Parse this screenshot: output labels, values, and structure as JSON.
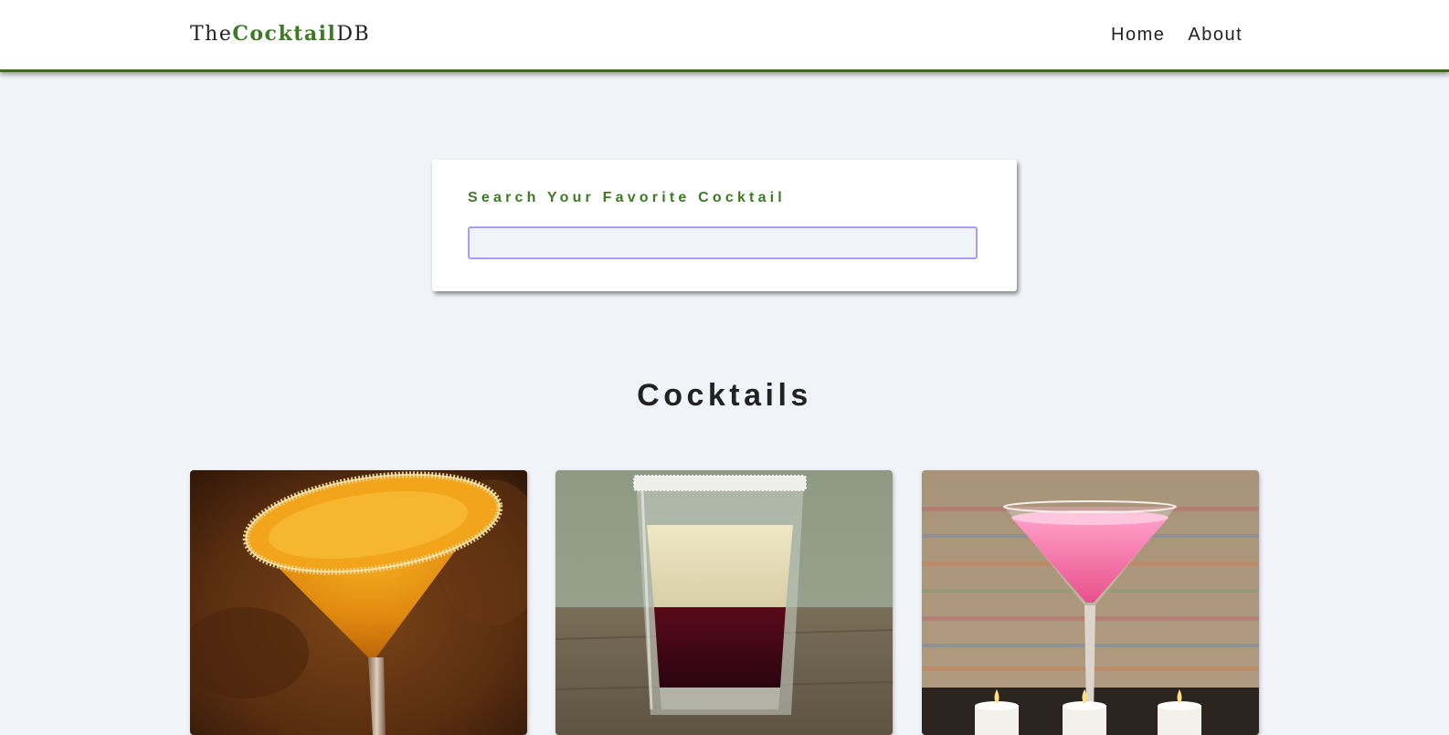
{
  "navbar": {
    "logo": {
      "prefix": "The",
      "highlight": "Cocktail",
      "suffix": "DB"
    },
    "links": [
      "Home",
      "About"
    ]
  },
  "search": {
    "label": "Search Your Favorite Cocktail",
    "value": "",
    "placeholder": ""
  },
  "cocktails": {
    "title": "Cocktails",
    "items": [
      {
        "image": "orange-martini-sugar-rim-photo"
      },
      {
        "image": "layered-shot-glass-photo"
      },
      {
        "image": "pink-martini-candles-photo"
      }
    ]
  },
  "colors": {
    "brand_green": "#3d7a26",
    "background": "#f0f3f8",
    "input_border": "#a99cf2"
  }
}
